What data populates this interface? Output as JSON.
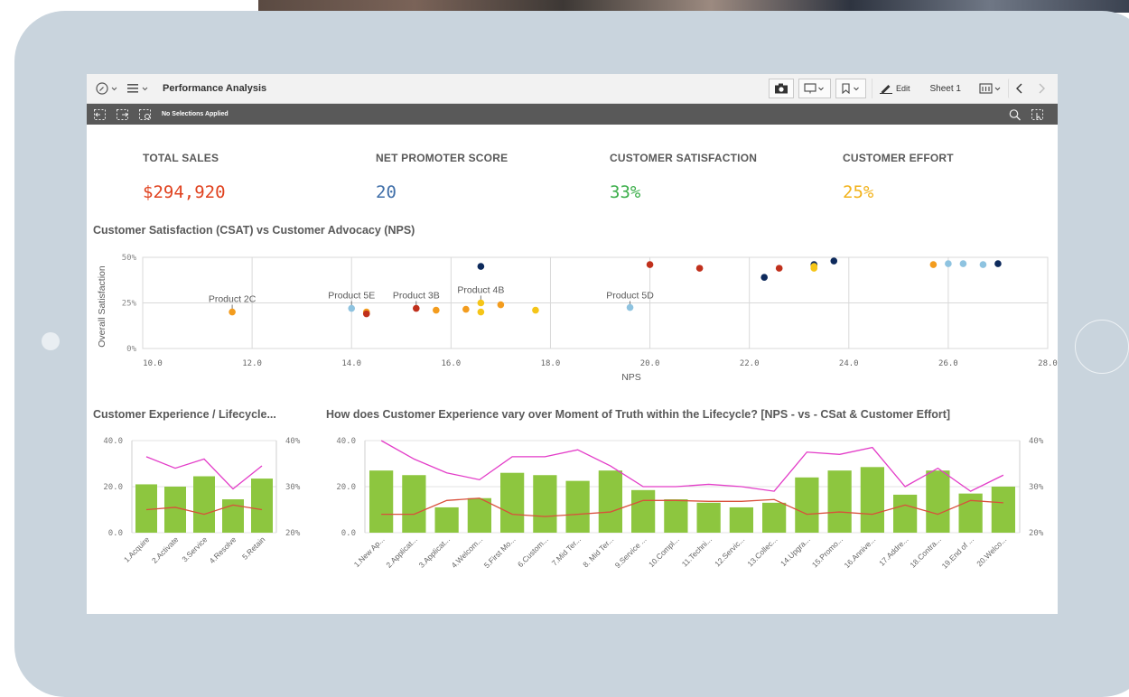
{
  "toolbar": {
    "app_title": "Performance Analysis",
    "edit_label": "Edit",
    "sheet_name": "Sheet 1"
  },
  "selection_bar": {
    "status": "No Selections Applied"
  },
  "kpis": [
    {
      "label": "TOTAL SALES",
      "value": "$294,920",
      "color": "#e0421f"
    },
    {
      "label": "NET PROMOTER SCORE",
      "value": "20",
      "color": "#3f6ea8"
    },
    {
      "label": "CUSTOMER SATISFACTION",
      "value": "33%",
      "color": "#3aae49"
    },
    {
      "label": "CUSTOMER EFFORT",
      "value": "25%",
      "color": "#f2b21a"
    }
  ],
  "titles": {
    "scatter": "Customer Satisfaction (CSAT) vs Customer Advocacy (NPS)",
    "lifecycle": "Customer Experience / Lifecycle...",
    "moments": "How does Customer Experience vary over Moment of Truth within the Lifecycle? [NPS - vs - CSat & Customer Effort]"
  },
  "chart_data": [
    {
      "type": "scatter",
      "xlabel": "NPS",
      "ylabel": "Overall Satisfaction",
      "xlim": [
        9.8,
        28
      ],
      "ylim": [
        0,
        0.5
      ],
      "x_ticks": [
        "10.0",
        "12.0",
        "14.0",
        "16.0",
        "18.0",
        "20.0",
        "22.0",
        "24.0",
        "26.0",
        "28.0"
      ],
      "y_ticks": [
        "0%",
        "25%",
        "50%"
      ],
      "grid": true,
      "points": [
        {
          "x": 11.6,
          "y": 0.2,
          "color": "#f39c1e"
        },
        {
          "x": 14.0,
          "y": 0.22,
          "color": "#8ec3e0"
        },
        {
          "x": 14.3,
          "y": 0.2,
          "color": "#f39c1e"
        },
        {
          "x": 14.3,
          "y": 0.19,
          "color": "#c0301c"
        },
        {
          "x": 15.3,
          "y": 0.22,
          "color": "#c0301c"
        },
        {
          "x": 15.7,
          "y": 0.21,
          "color": "#f39c1e"
        },
        {
          "x": 16.3,
          "y": 0.215,
          "color": "#f39c1e"
        },
        {
          "x": 16.6,
          "y": 0.45,
          "color": "#0d2a5c"
        },
        {
          "x": 16.6,
          "y": 0.25,
          "color": "#f5c518"
        },
        {
          "x": 16.6,
          "y": 0.2,
          "color": "#f5c518"
        },
        {
          "x": 17.0,
          "y": 0.24,
          "color": "#f39c1e"
        },
        {
          "x": 17.7,
          "y": 0.21,
          "color": "#f5c518"
        },
        {
          "x": 19.6,
          "y": 0.225,
          "color": "#8ec3e0"
        },
        {
          "x": 20.0,
          "y": 0.46,
          "color": "#c0301c"
        },
        {
          "x": 21.0,
          "y": 0.44,
          "color": "#c0301c"
        },
        {
          "x": 22.3,
          "y": 0.39,
          "color": "#0d2a5c"
        },
        {
          "x": 22.6,
          "y": 0.44,
          "color": "#c0301c"
        },
        {
          "x": 23.3,
          "y": 0.46,
          "color": "#0d2a5c"
        },
        {
          "x": 23.3,
          "y": 0.45,
          "color": "#f5c518"
        },
        {
          "x": 23.3,
          "y": 0.44,
          "color": "#f5c518"
        },
        {
          "x": 23.7,
          "y": 0.48,
          "color": "#0d2a5c"
        },
        {
          "x": 25.7,
          "y": 0.46,
          "color": "#f39c1e"
        },
        {
          "x": 26.0,
          "y": 0.465,
          "color": "#8ec3e0"
        },
        {
          "x": 26.3,
          "y": 0.465,
          "color": "#8ec3e0"
        },
        {
          "x": 26.7,
          "y": 0.46,
          "color": "#8ec3e0"
        },
        {
          "x": 27.0,
          "y": 0.465,
          "color": "#0d2a5c"
        }
      ],
      "annotations": [
        {
          "text": "Product 2C",
          "x": 11.6,
          "y": 0.25
        },
        {
          "text": "Product 5E",
          "x": 14.0,
          "y": 0.27
        },
        {
          "text": "Product 3B",
          "x": 15.3,
          "y": 0.27
        },
        {
          "text": "Product 4B",
          "x": 16.6,
          "y": 0.3
        },
        {
          "text": "Product 5D",
          "x": 19.6,
          "y": 0.27
        }
      ]
    },
    {
      "type": "bar",
      "categories": [
        "1.Acquire",
        "2.Activate",
        "3.Service",
        "4.Resolve",
        "5.Retain"
      ],
      "ylim": [
        0,
        40
      ],
      "y_ticks": [
        "0.0",
        "20.0",
        "40.0"
      ],
      "y2lim": [
        0.2,
        0.4
      ],
      "y2_ticks": [
        "20%",
        "30%",
        "40%"
      ],
      "bar_color": "#8dc63f",
      "series": [
        {
          "values": [
            21,
            20,
            24.5,
            14.5,
            23.5
          ]
        },
        {
          "values": [
            0.365,
            0.34,
            0.36,
            0.295,
            0.345
          ],
          "axis": "y2",
          "color": "#e33cc8"
        },
        {
          "values": [
            0.25,
            0.255,
            0.24,
            0.26,
            0.25
          ],
          "axis": "y2",
          "color": "#d94f3b"
        }
      ]
    },
    {
      "type": "bar",
      "categories": [
        "1.New Ap...",
        "2.Applicat...",
        "3.Applicat...",
        "4.Welcom...",
        "5.First Mo...",
        "6.Custom...",
        "7.Mid Ter...",
        "8. Mid Ter...",
        "9.Service ...",
        "10.Compl...",
        "11.Techni...",
        "12.Servic...",
        "13.Collec...",
        "14.Upgra...",
        "15.Promo...",
        "16.Annive...",
        "17.Addre...",
        "18.Contra...",
        "19.End of ...",
        "20.Welco..."
      ],
      "ylim": [
        0,
        40
      ],
      "y_ticks": [
        "0.0",
        "20.0",
        "40.0"
      ],
      "y2lim": [
        0.2,
        0.4
      ],
      "y2_ticks": [
        "20%",
        "30%",
        "40%"
      ],
      "bar_color": "#8dc63f",
      "series": [
        {
          "values": [
            27,
            25,
            11,
            15,
            26,
            25,
            22.5,
            27,
            18.5,
            14.5,
            13,
            11,
            13,
            24,
            27,
            28.5,
            16.5,
            27,
            17,
            20
          ]
        },
        {
          "values": [
            0.4,
            0.36,
            0.33,
            0.315,
            0.365,
            0.365,
            0.38,
            0.345,
            0.3,
            0.3,
            0.305,
            0.3,
            0.29,
            0.375,
            0.37,
            0.385,
            0.3,
            0.34,
            0.29,
            0.325
          ],
          "axis": "y2",
          "color": "#e33cc8"
        },
        {
          "values": [
            0.24,
            0.24,
            0.27,
            0.275,
            0.24,
            0.235,
            0.24,
            0.245,
            0.27,
            0.27,
            0.268,
            0.268,
            0.272,
            0.24,
            0.245,
            0.24,
            0.26,
            0.24,
            0.27,
            0.265
          ],
          "axis": "y2",
          "color": "#d94f3b"
        }
      ]
    }
  ]
}
